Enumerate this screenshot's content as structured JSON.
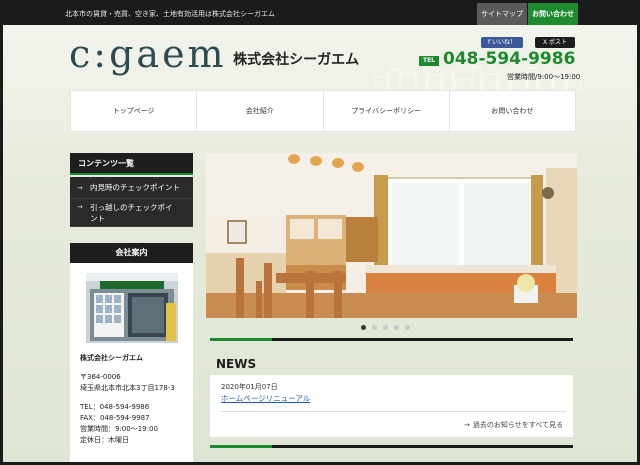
{
  "topbar": {
    "tagline": "北本市の賃貸・売買、空き家、土地有効活用は株式会社シーガエム",
    "sitemap_label": "サイトマップ",
    "contact_label": "お問い合わせ"
  },
  "header": {
    "logo_text": "c:gaem",
    "company_name": "株式会社シーガエム",
    "fb_label": "いいね！",
    "tw_label": "ポスト",
    "tel_badge": "TEL",
    "tel_number": "048-594-9986",
    "hours": "営業時間/9:00～19:00"
  },
  "nav": {
    "items": [
      {
        "label": "トップページ"
      },
      {
        "label": "会社紹介"
      },
      {
        "label": "プライバシーポリシー"
      },
      {
        "label": "お問い合わせ"
      }
    ]
  },
  "sidebar": {
    "contents_title": "コンテンツ一覧",
    "links": [
      {
        "label": "内見時のチェックポイント"
      },
      {
        "label": "引っ越しのチェックポイ",
        "label2": "ント"
      }
    ],
    "company_title": "会社案内",
    "company": {
      "name": "株式会社シーガエム",
      "postal": "〒364-0006",
      "address": "埼玉県北本市北本3丁目178-3",
      "tel": "TEL：048-594-9986",
      "fax": "FAX：048-594-9987",
      "hours": "営業時間：9:00～19:00",
      "holiday": "定休日：木曜日"
    }
  },
  "slider": {
    "dot_count": 5,
    "active_index": 0
  },
  "news": {
    "title": "NEWS",
    "date": "2020年01月07日",
    "headline": "ホームページリニューアル",
    "all_link": "過去のお知らせをすべて見る"
  },
  "colors": {
    "brand_green": "#1e8a2e",
    "dark": "#1b1b1b",
    "logo": "#2e4b52"
  }
}
